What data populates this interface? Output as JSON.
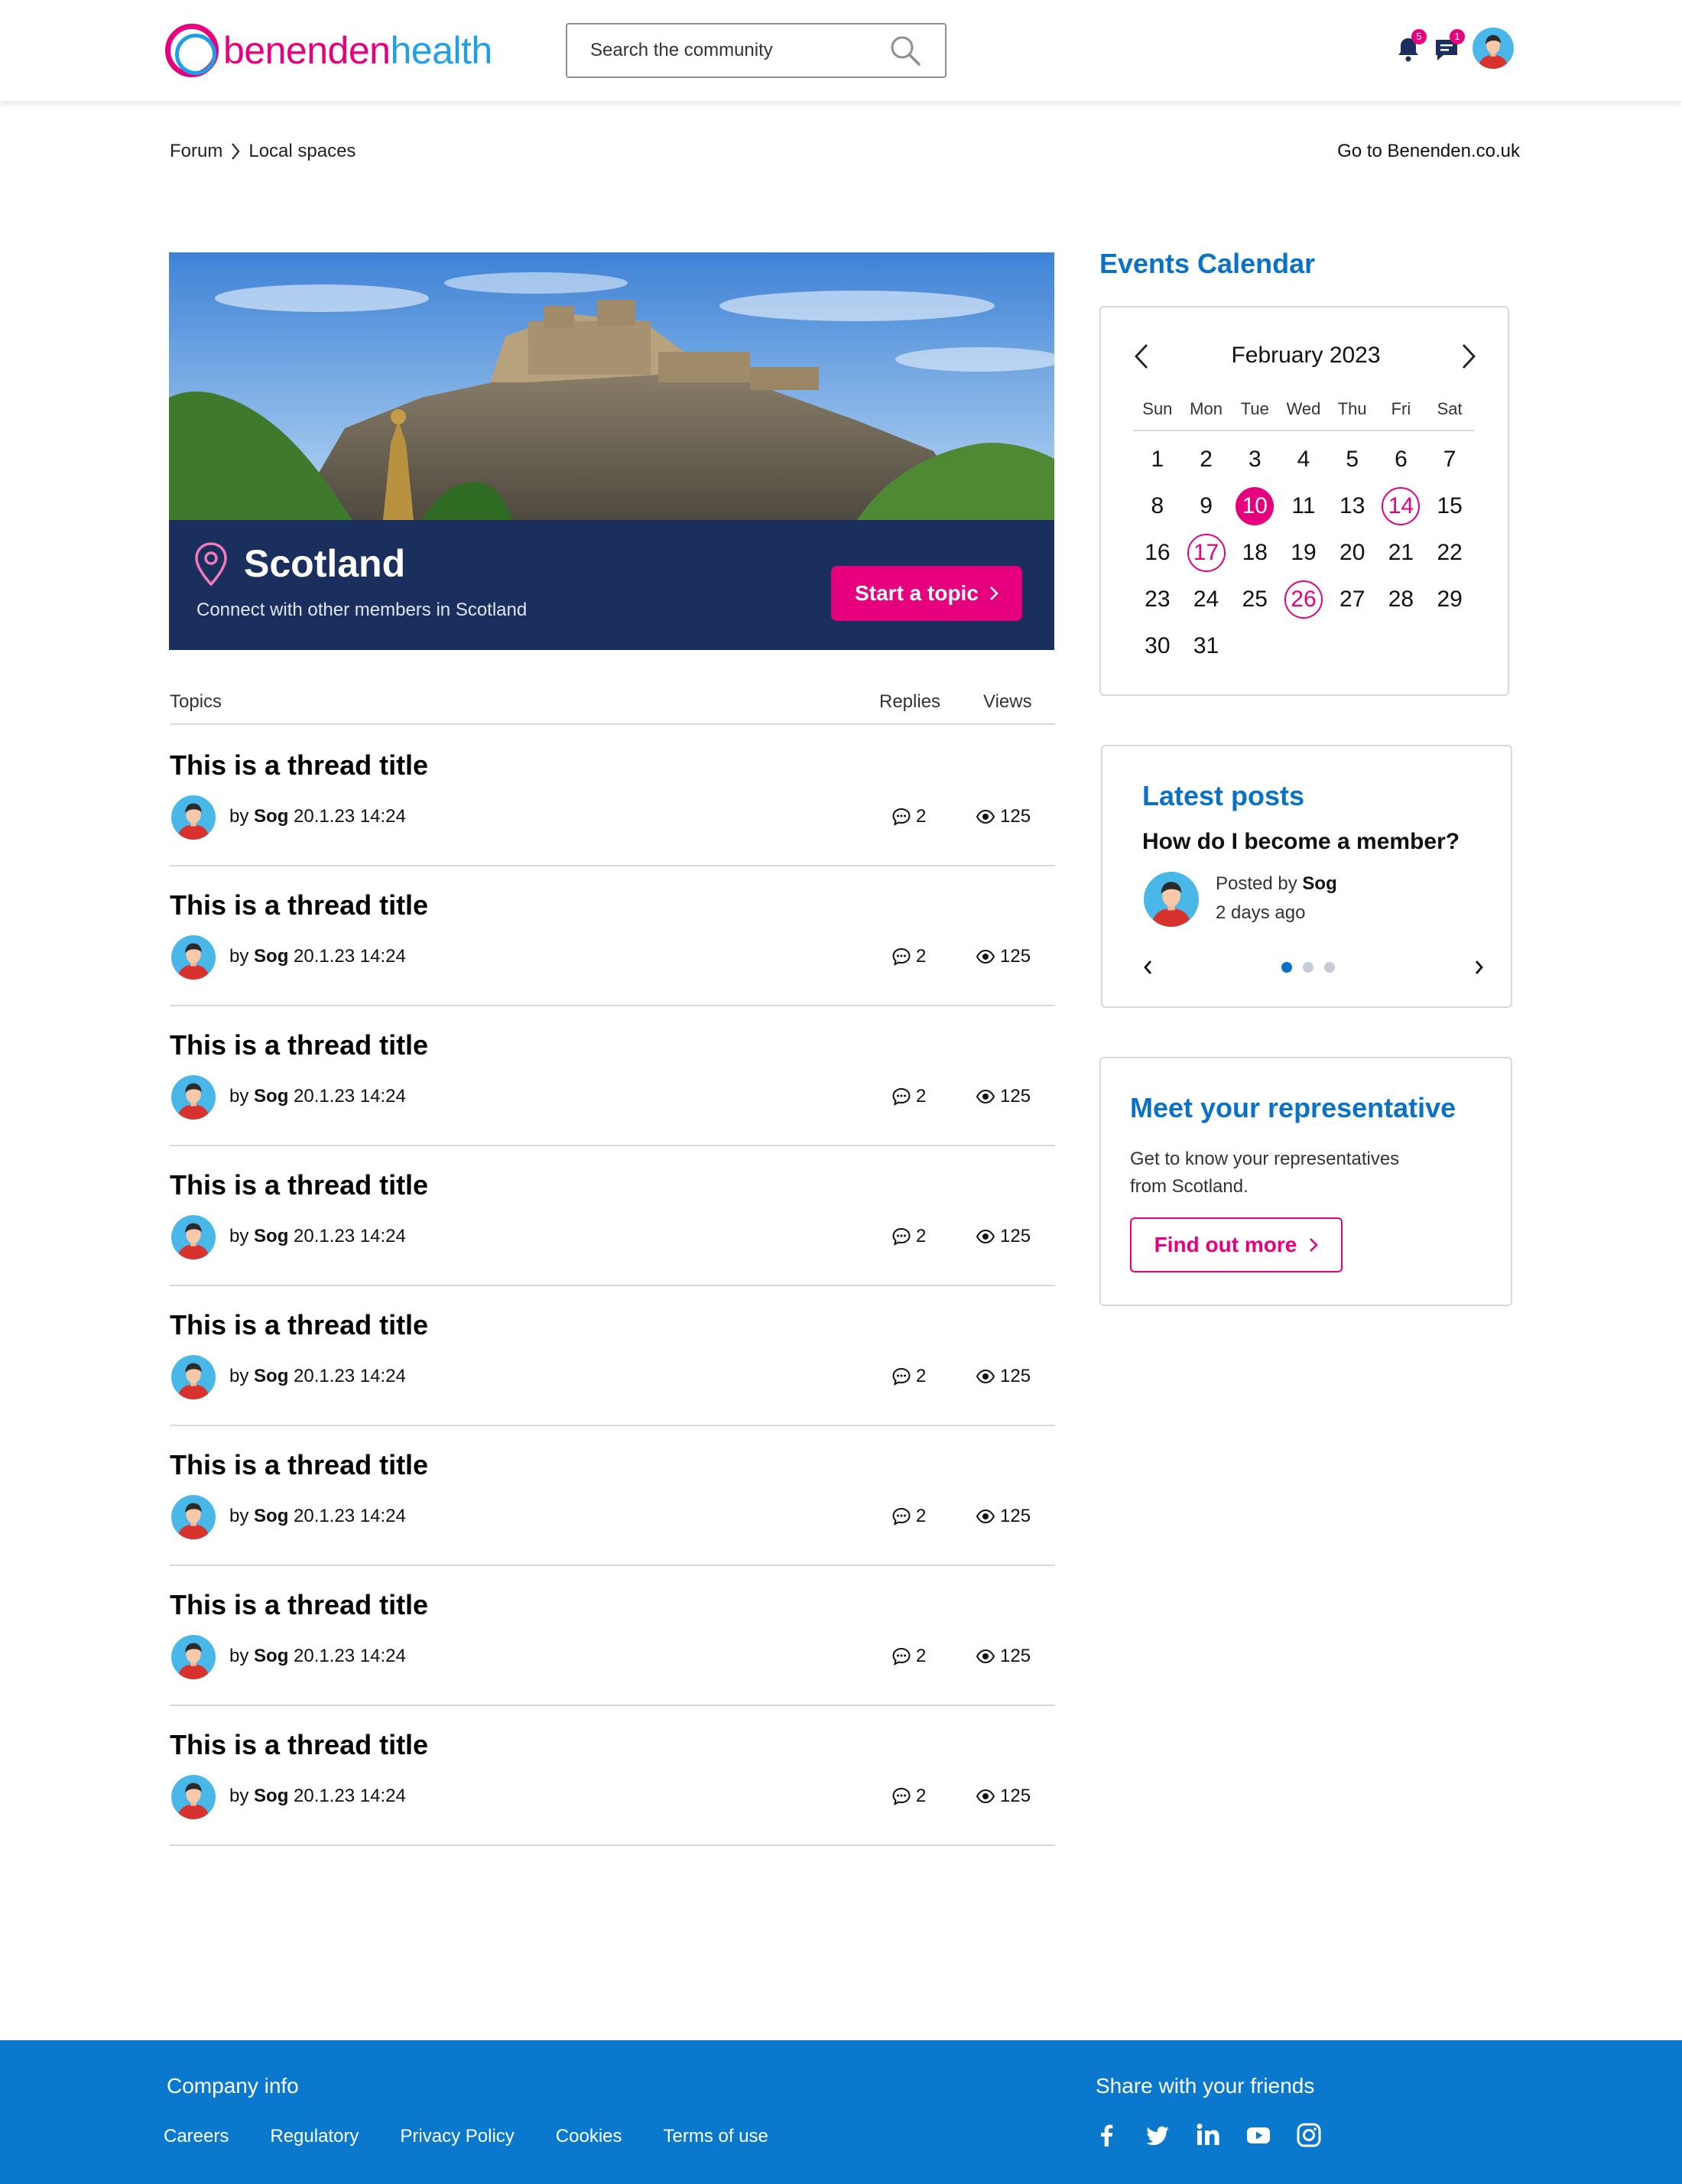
{
  "header": {
    "logo": {
      "part1": "benenden",
      "part2": "health"
    },
    "search_placeholder": "Search the community",
    "notifications_count": "5",
    "messages_count": "1"
  },
  "breadcrumb": {
    "items": [
      "Forum",
      "Local spaces"
    ],
    "external_link": "Go to Benenden.co.uk"
  },
  "hero": {
    "title": "Scotland",
    "subtitle": "Connect with other members in Scotland",
    "cta": "Start a topic"
  },
  "topics": {
    "headers": {
      "topics": "Topics",
      "replies": "Replies",
      "views": "Views"
    },
    "threads": [
      {
        "title": "This is a thread title",
        "by": "by",
        "author": "Sog",
        "date": "20.1.23 14:24",
        "replies": "2",
        "views": "125"
      },
      {
        "title": "This is a thread title",
        "by": "by",
        "author": "Sog",
        "date": "20.1.23 14:24",
        "replies": "2",
        "views": "125"
      },
      {
        "title": "This is a thread title",
        "by": "by",
        "author": "Sog",
        "date": "20.1.23 14:24",
        "replies": "2",
        "views": "125"
      },
      {
        "title": "This is a thread title",
        "by": "by",
        "author": "Sog",
        "date": "20.1.23 14:24",
        "replies": "2",
        "views": "125"
      },
      {
        "title": "This is a thread title",
        "by": "by",
        "author": "Sog",
        "date": "20.1.23 14:24",
        "replies": "2",
        "views": "125"
      },
      {
        "title": "This is a thread title",
        "by": "by",
        "author": "Sog",
        "date": "20.1.23 14:24",
        "replies": "2",
        "views": "125"
      },
      {
        "title": "This is a thread title",
        "by": "by",
        "author": "Sog",
        "date": "20.1.23 14:24",
        "replies": "2",
        "views": "125"
      },
      {
        "title": "This is a thread title",
        "by": "by",
        "author": "Sog",
        "date": "20.1.23 14:24",
        "replies": "2",
        "views": "125"
      }
    ]
  },
  "calendar": {
    "heading": "Events Calendar",
    "month": "February 2023",
    "weekdays": [
      "Sun",
      "Mon",
      "Tue",
      "Wed",
      "Thu",
      "Fri",
      "Sat"
    ],
    "weeks": [
      [
        "1",
        "2",
        "3",
        "4",
        "5",
        "6",
        "7"
      ],
      [
        "8",
        "9",
        "10",
        "11",
        "13",
        "14",
        "15"
      ],
      [
        "16",
        "17",
        "18",
        "19",
        "20",
        "21",
        "22"
      ],
      [
        "23",
        "24",
        "25",
        "26",
        "27",
        "28",
        "29"
      ],
      [
        "30",
        "31",
        "",
        "",
        "",
        "",
        ""
      ]
    ],
    "today": "10",
    "event_days": [
      "14",
      "17",
      "26"
    ]
  },
  "latest_posts": {
    "heading": "Latest posts",
    "question": "How do I become a member?",
    "posted_by_label": "Posted by",
    "author": "Sog",
    "time_ago": "2 days ago",
    "slide_count": 3,
    "active_slide": 1
  },
  "representative": {
    "heading": "Meet your representative",
    "text": "Get to know your representatives from Scotland.",
    "cta": "Find out more"
  },
  "footer": {
    "company_heading": "Company info",
    "links": [
      "Careers",
      "Regulatory",
      "Privacy Policy",
      "Cookies",
      "Terms of use"
    ],
    "share_heading": "Share with your friends",
    "socials": [
      "facebook-icon",
      "twitter-icon",
      "linkedin-icon",
      "youtube-icon",
      "instagram-icon"
    ]
  },
  "colors": {
    "brand_pink": "#e6007e",
    "brand_blue": "#0a72c6",
    "hero_navy": "#1b2f5e",
    "footer_blue": "#0a78cc"
  }
}
